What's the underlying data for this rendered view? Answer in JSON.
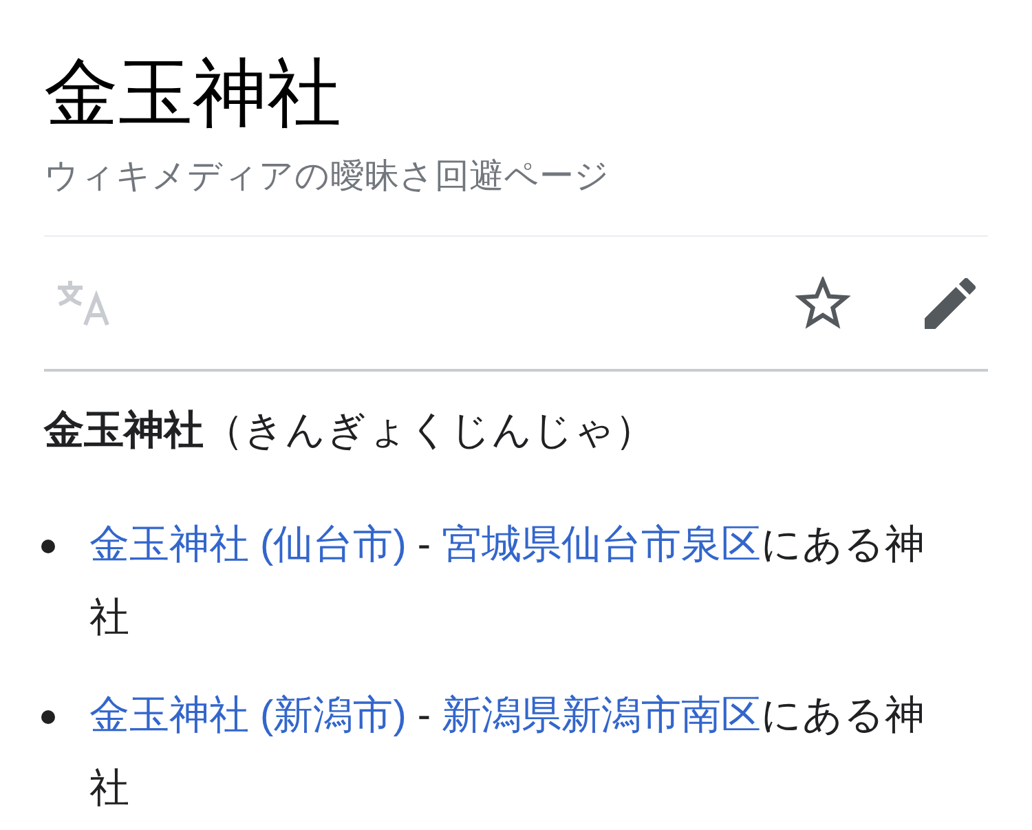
{
  "header": {
    "title": "金玉神社",
    "subtitle": "ウィキメディアの曖昧さ回避ページ"
  },
  "toolbar": {
    "buttons": [
      {
        "kind": "language",
        "disabled": true
      },
      {
        "kind": "watch",
        "disabled": false
      },
      {
        "kind": "edit",
        "disabled": false
      }
    ]
  },
  "content": {
    "lead": "**金玉神社**（きんぎょくじんじゃ）",
    "items": [
      {
        "title_link": "金玉神社 (仙台市)",
        "separator": "-",
        "location_link": "宮城県仙台市泉区",
        "description": "にある神社"
      },
      {
        "title_link": "金玉神社 (新潟市)",
        "separator": "-",
        "location_link": "新潟県新潟市南区",
        "description": "にある神社"
      }
    ]
  }
}
